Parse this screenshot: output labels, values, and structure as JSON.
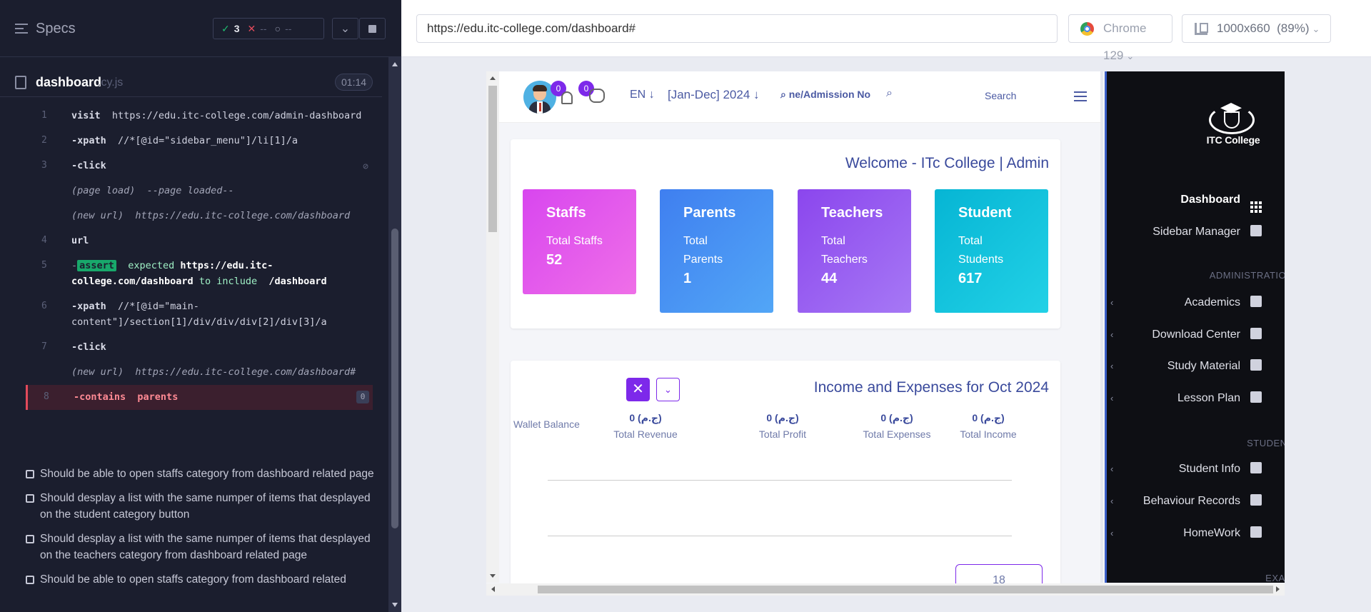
{
  "runner": {
    "specs_title": "Specs",
    "stats": {
      "passed": "3",
      "failed": "--",
      "pending": "--"
    },
    "file": {
      "name": "dashboard",
      "ext": ".cy.js",
      "time": "01:14"
    },
    "commands": [
      {
        "num": "1",
        "name": "visit",
        "args": "https://edu.itc-college.com/admin-dashboard"
      },
      {
        "num": "2",
        "name": "-xpath",
        "args": "//*[@id=\"sidebar_menu\"]/li[1]/a"
      },
      {
        "num": "3",
        "name": "-click",
        "args": ""
      },
      {
        "num": "",
        "name": "(page load)",
        "args": "--page loaded--"
      },
      {
        "num": "",
        "name": "(new url)",
        "args": "https://edu.itc-college.com/dashboard"
      },
      {
        "num": "4",
        "name": "url",
        "args": ""
      },
      {
        "num": "5",
        "name": "-",
        "badge": "assert",
        "expected": "expected",
        "url": "https://edu.itc-college.com/dashboard",
        "to_include": "to include",
        "path": "/dashboard"
      },
      {
        "num": "6",
        "name": "-xpath",
        "args": "//*[@id=\"main-content\"]/section[1]/div/div/div[2]/div[3]/a"
      },
      {
        "num": "7",
        "name": "-click",
        "args": ""
      },
      {
        "num": "",
        "name": "(new url)",
        "args": "https://edu.itc-college.com/dashboard#"
      },
      {
        "num": "8",
        "name": "-contains",
        "args": "parents",
        "count": "0"
      }
    ],
    "tests": [
      "Should be able to open staffs category from dashboard related page",
      "Should desplay a list with the same numper of items that desplayed on the student category button",
      "Should desplay a list with the same numper of items that desplayed on the teachers category from dashboard related page",
      "Should be able to open staffs category from dashboard related"
    ]
  },
  "browser": {
    "url": "https://edu.itc-college.com/dashboard#",
    "name": "Chrome 129",
    "viewport": "1000x660",
    "zoom": "(89%)"
  },
  "app": {
    "header": {
      "notif_count": "0",
      "msg_count": "0",
      "lang": "EN",
      "year": "[Jan-Dec] 2024",
      "search_placeholder": "ne/Admission No",
      "search_btn": "Search"
    },
    "welcome": "Welcome - ITc College | Admin",
    "tiles": [
      {
        "title": "Staffs",
        "sub1": "Total Staffs",
        "sub2": "",
        "value": "52"
      },
      {
        "title": "Parents",
        "sub1": "Total",
        "sub2": "Parents",
        "value": "1"
      },
      {
        "title": "Teachers",
        "sub1": "Total",
        "sub2": "Teachers",
        "value": "44"
      },
      {
        "title": "Student",
        "sub1": "Total",
        "sub2": "Students",
        "value": "617"
      }
    ],
    "income": {
      "title": "Income and Expenses for Oct 2024",
      "wallet": "Wallet Balance",
      "metrics": [
        {
          "value": "0 (ج.م)",
          "label": "Total Revenue"
        },
        {
          "value": "0 (ج.م)",
          "label": "Total Profit"
        },
        {
          "value": "0 (ج.م)",
          "label": "Total Expenses"
        },
        {
          "value": "0 (ج.م)",
          "label": "Total Income"
        }
      ],
      "page_box": "18"
    },
    "sidebar": {
      "logo_text": "ITC College",
      "items": [
        {
          "label": "Dashboard",
          "icon": "grid-icon"
        },
        {
          "label": "Sidebar Manager",
          "icon": "menu-icon"
        },
        {
          "label": "Academics",
          "icon": "graduation-cap-icon"
        },
        {
          "label": "Download Center",
          "icon": "download-icon"
        },
        {
          "label": "Study Material",
          "icon": "download-icon"
        },
        {
          "label": "Lesson Plan",
          "icon": "list-icon"
        },
        {
          "label": "Student Info",
          "icon": "user-icon"
        },
        {
          "label": "Behaviour Records",
          "icon": "copy-icon"
        },
        {
          "label": "HomeWork",
          "icon": "book-icon"
        }
      ],
      "sections": [
        "ADMINISTRATION",
        "STUDENT",
        "EXAM"
      ]
    }
  }
}
